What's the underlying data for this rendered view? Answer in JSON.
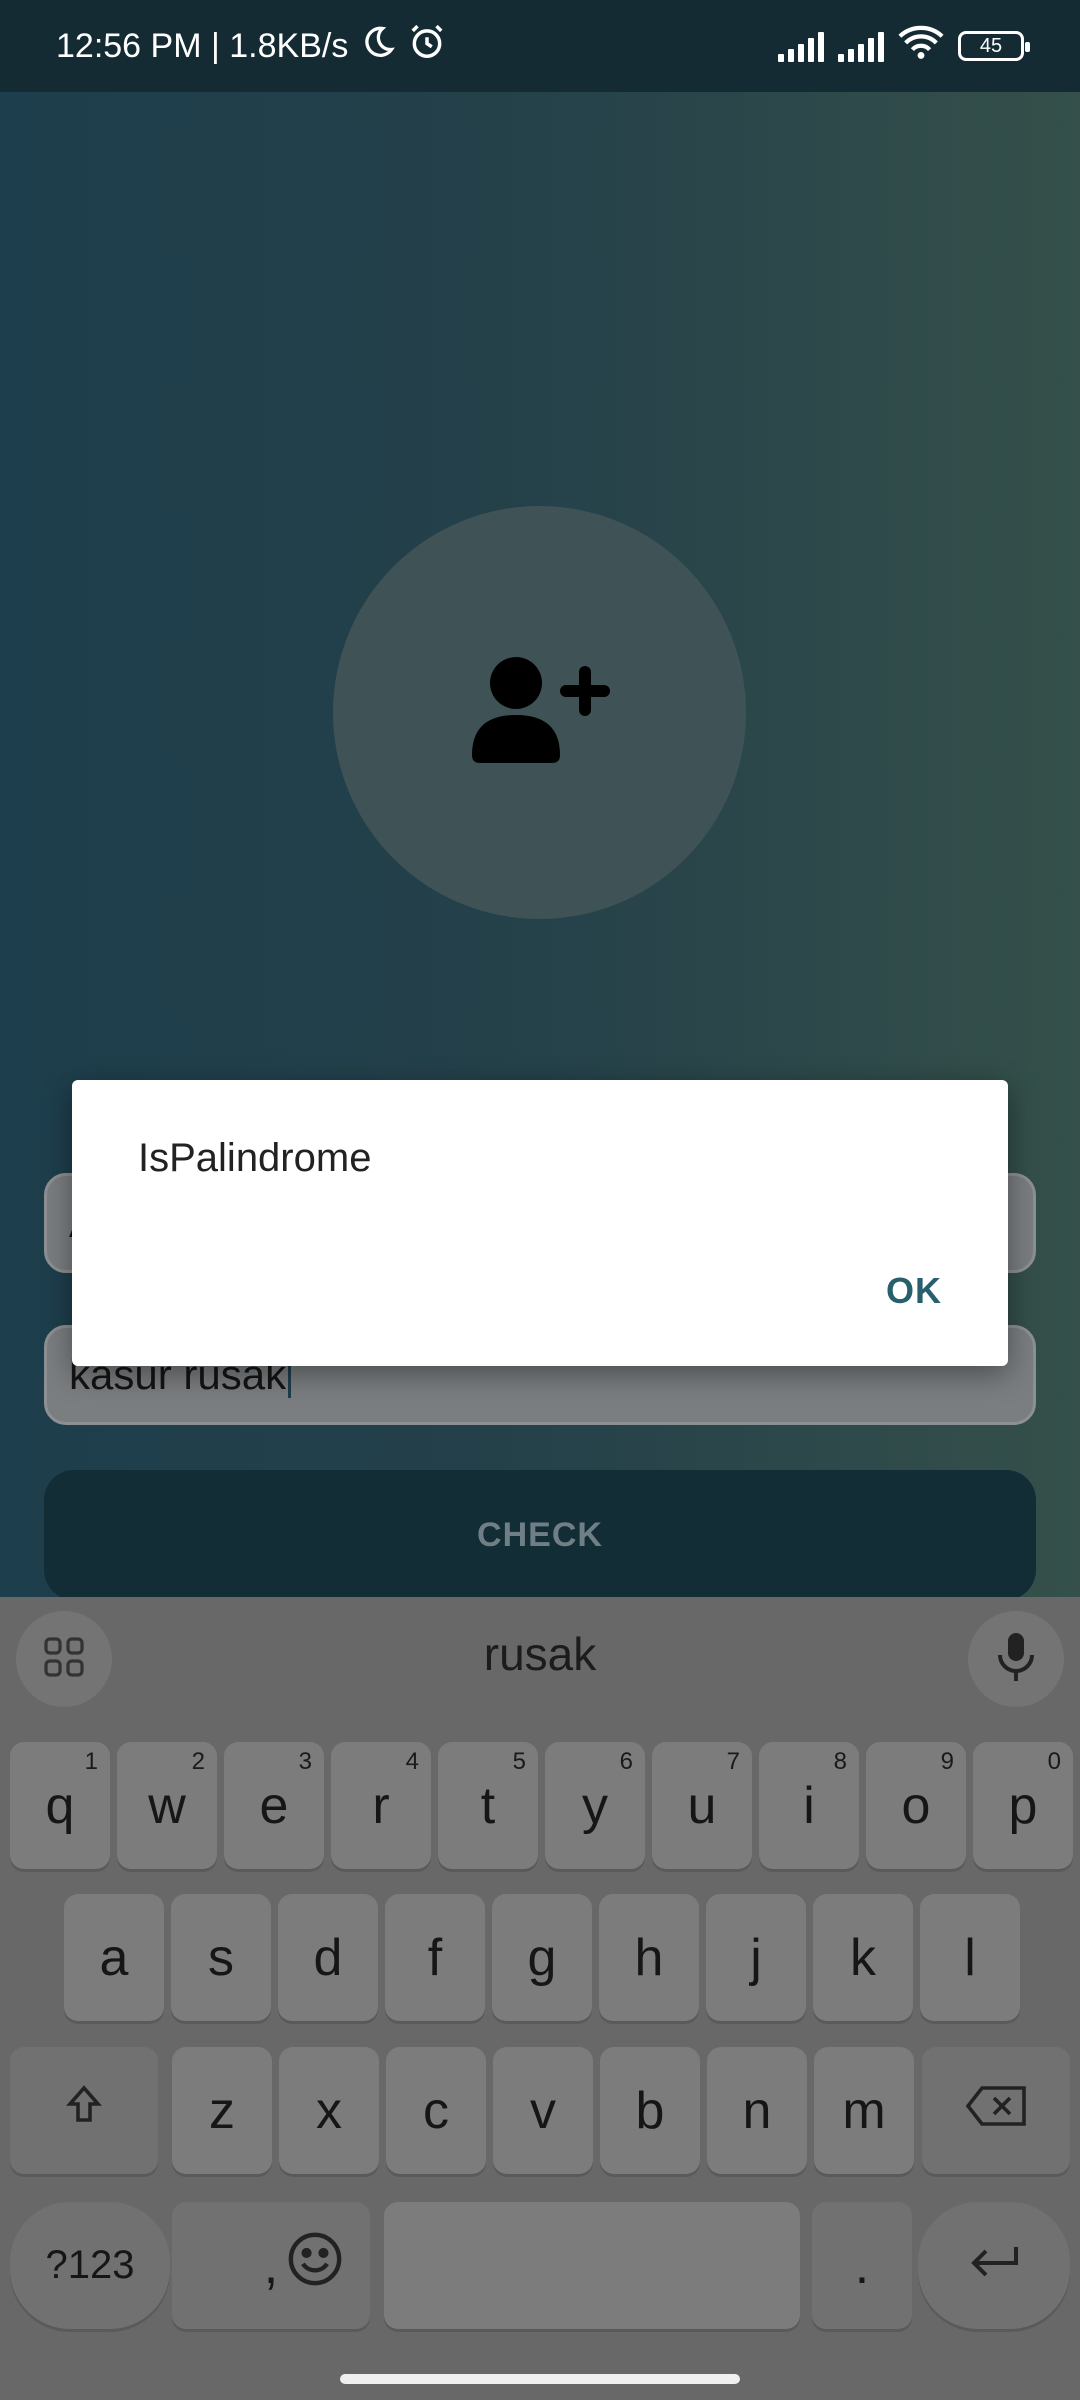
{
  "status_bar": {
    "time_speed": "12:56 PM | 1.8KB/s",
    "battery": "45"
  },
  "form": {
    "field_1_value": "A",
    "field_2_value": "kasur rusak",
    "check_label": "CHECK"
  },
  "dialog": {
    "message": "IsPalindrome",
    "ok_label": "OK"
  },
  "keyboard": {
    "suggestion": "rusak",
    "row1": [
      {
        "key": "q",
        "hint": "1"
      },
      {
        "key": "w",
        "hint": "2"
      },
      {
        "key": "e",
        "hint": "3"
      },
      {
        "key": "r",
        "hint": "4"
      },
      {
        "key": "t",
        "hint": "5"
      },
      {
        "key": "y",
        "hint": "6"
      },
      {
        "key": "u",
        "hint": "7"
      },
      {
        "key": "i",
        "hint": "8"
      },
      {
        "key": "o",
        "hint": "9"
      },
      {
        "key": "p",
        "hint": "0"
      }
    ],
    "row2": [
      "a",
      "s",
      "d",
      "f",
      "g",
      "h",
      "j",
      "k",
      "l"
    ],
    "row3": [
      "z",
      "x",
      "c",
      "v",
      "b",
      "n",
      "m"
    ],
    "symbols_label": "?123",
    "comma_label": ",",
    "period_label": "."
  },
  "icons": {
    "moon": "moon-icon",
    "alarm": "alarm-icon",
    "wifi": "wifi-icon",
    "add_user": "add-user-icon",
    "grid": "grid-icon",
    "mic": "mic-icon",
    "shift": "shift-icon",
    "backspace": "backspace-icon",
    "emoji": "emoji-icon",
    "enter": "enter-icon"
  }
}
